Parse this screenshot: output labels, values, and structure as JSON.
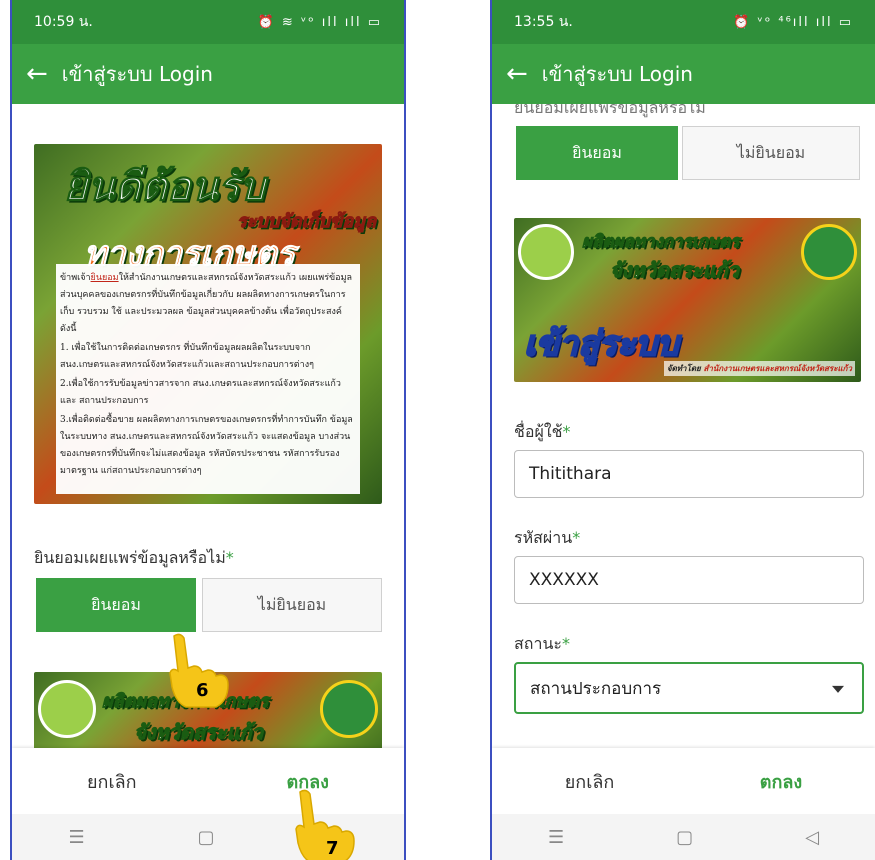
{
  "left": {
    "status": {
      "time": "10:59 น.",
      "icons": "⏰ ≋ ᵛᵒ ıll ıll ▭"
    },
    "appbar": {
      "title": "เข้าสู่ระบบ Login"
    },
    "banner": {
      "line1": "ยินดีต้อนรับ",
      "line2": "ระบบจัดเก็บข้อมูล",
      "line3": "ทางการเกษตร",
      "notice": {
        "p1_pre": "ข้าพเจ้า",
        "p1_hl": "ยินยอม",
        "p1_post": "ให้สำนักงานเกษตรและสหกรณ์จังหวัดสระแก้ว เผยแพร่ข้อมูลส่วนบุคคลของเกษตรกรที่บันทึกข้อมูลเกี่ยวกับ ผลผลิตทางการเกษตรในการเก็บ รวบรวม ใช้ และประมวลผล ข้อมูลส่วนบุคคลข้างต้น เพื่อวัตถุประสงค์ดังนี้",
        "p2": "1. เพื่อใช้ในการติดต่อเกษตรกร ที่บันทึกข้อมูลผลผลิตในระบบจาก สนง.เกษตรและสหกรณ์จังหวัดสระแก้วและสถานประกอบการต่างๆ",
        "p3": "2.เพื่อใช้การรับข้อมูลข่าวสารจาก สนง.เกษตรและสหกรณ์จังหวัดสระแก้ว และ สถานประกอบการ",
        "p4": "3.เพื่อติดต่อซื้อขาย ผลผลิตทางการเกษตรของเกษตรกรที่ทำการบันทึก ข้อมูลในระบบทาง สนง.เกษตรและสหกรณ์จังหวัดสระแก้ว จะแสดงข้อมูล บางส่วนของเกษตรกรที่บันทึกจะไม่แสดงข้อมูล รหัสบัตรประชาชน รหัสการรับรองมาตรฐาน แก่สถานประกอบการต่างๆ"
      }
    },
    "consent": {
      "label": "ยินยอมเผยแพร่ข้อมูลหรือไม่",
      "required_mark": "*",
      "accept": "ยินยอม",
      "decline": "ไม่ยินยอม"
    },
    "banner2": {
      "line1": "ผลิตผลทางการเกษตร",
      "line2": "จังหวัดสระแก้ว"
    },
    "bottom": {
      "cancel": "ยกเลิก",
      "ok": "ตกลง"
    },
    "nav": {
      "recent": "☰",
      "home": "▢"
    },
    "steps": {
      "s6": "6",
      "s7": "7"
    }
  },
  "right": {
    "status": {
      "time": "13:55 น.",
      "icons": "⏰ ᵛᵒ ⁴⁶ıll ıll ▭"
    },
    "appbar": {
      "title": "เข้าสู่ระบบ Login"
    },
    "consent_partial": "ยินยอมเผยแพร่ข้อมูลหรือไม่",
    "consent": {
      "accept": "ยินยอม",
      "decline": "ไม่ยินยอม"
    },
    "banner": {
      "line1": "ผลิตผลทางการเกษตร",
      "line2": "จังหวัดสระแก้ว",
      "line3": "เข้าสู่ระบบ",
      "credit_pre": "จัดทำโดย",
      "credit": "สำนักงานเกษตรและสหกรณ์จังหวัดสระแก้ว"
    },
    "username": {
      "label": "ชื่อผู้ใช้",
      "required_mark": "*",
      "value": "Thitithara"
    },
    "password": {
      "label": "รหัสผ่าน",
      "required_mark": "*",
      "value": "XXXXXX"
    },
    "status_field": {
      "label": "สถานะ",
      "required_mark": "*",
      "value": "สถานประกอบการ"
    },
    "bottom": {
      "cancel": "ยกเลิก",
      "ok": "ตกลง"
    },
    "nav": {
      "recent": "☰",
      "home": "▢",
      "back": "◁"
    }
  },
  "colors": {
    "primary": "#3aa043",
    "statusbar": "#2f8f3a",
    "frame": "#3c4fc0",
    "hand": "#f5c518"
  }
}
